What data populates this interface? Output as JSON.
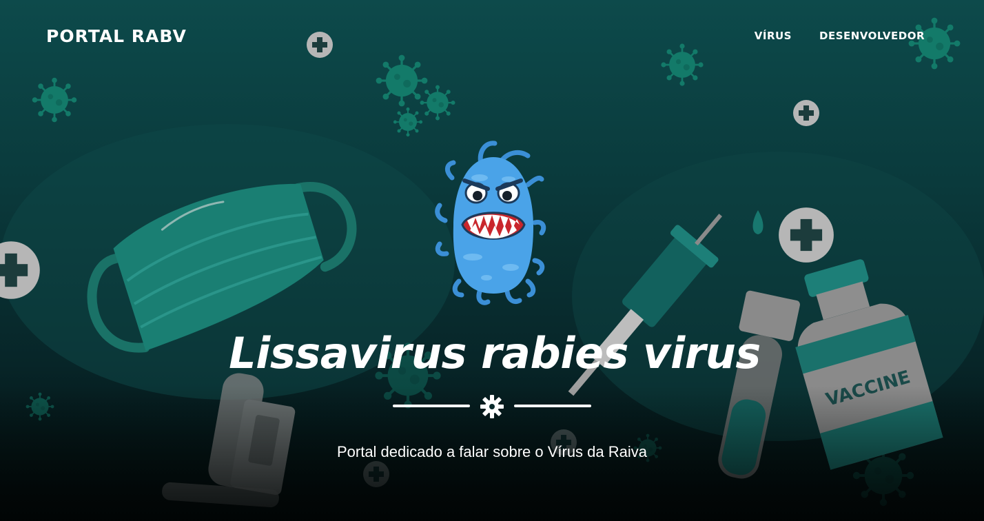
{
  "brand": {
    "name": "PORTAL RABV"
  },
  "nav": {
    "items": [
      {
        "label": "VÍRUS"
      },
      {
        "label": "DESENVOLVEDOR"
      }
    ]
  },
  "hero": {
    "title": "Lissavirus rabies virus",
    "subtitle": "Portal dedicado a falar sobre o Vírus da Raiva",
    "divider_icon": "gear-icon",
    "mascot_icon": "virus-mascot-icon"
  },
  "background": {
    "vaccine_label": "VACCINE",
    "icons": [
      "virus-icon",
      "medical-cross-icon",
      "face-mask-icon",
      "syringe-icon",
      "vaccine-vial-icon",
      "test-tube-icon",
      "test-kit-icon",
      "thermometer-icon",
      "water-drop-icon"
    ]
  },
  "colors": {
    "background_top": "#0d4a4b",
    "background_bottom": "#020808",
    "virus_teal": "#16806f",
    "mascot_blue": "#4aa3e8",
    "text": "#ffffff"
  }
}
